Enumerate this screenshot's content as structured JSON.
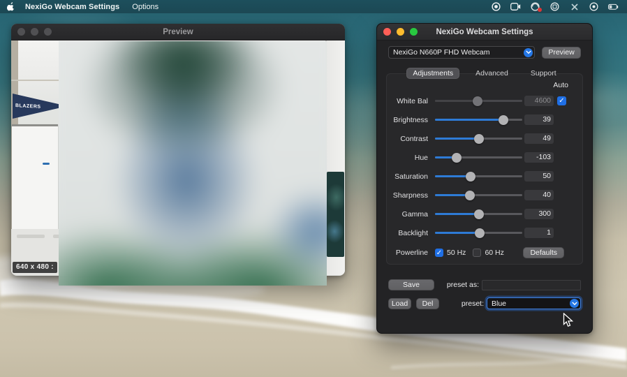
{
  "colors": {
    "accent_blue": "#2e7bd6",
    "checkbox_blue": "#1f6fe5",
    "traffic_red": "#ff5f57",
    "traffic_yellow": "#febc2e",
    "traffic_green": "#28c840"
  },
  "menu_bar": {
    "app_name": "NexiGo Webcam Settings",
    "menus": [
      {
        "label": "Options"
      }
    ],
    "status_icons": [
      "record-icon",
      "video-camera-icon",
      "meeting-red-badge-icon",
      "circled-grid-icon",
      "x-tool-icon",
      "circled-dot-icon",
      "battery-icon"
    ]
  },
  "preview_window": {
    "title": "Preview",
    "resolution_badge": "640 x 480 :",
    "pennant_text": "BLAZERS"
  },
  "settings_window": {
    "title": "NexiGo Webcam Settings",
    "device_select": {
      "value": "NexiGo N660P FHD Webcam"
    },
    "preview_button": "Preview",
    "tabs": [
      {
        "label": "Adjustments",
        "active": true
      },
      {
        "label": "Advanced",
        "active": false
      },
      {
        "label": "Support",
        "active": false
      }
    ],
    "auto_label": "Auto",
    "auto_checked": true,
    "sliders": [
      {
        "label": "White Bal",
        "value": "4600",
        "fraction": 0.49,
        "disabled": true
      },
      {
        "label": "Brightness",
        "value": "39",
        "fraction": 0.78,
        "disabled": false
      },
      {
        "label": "Contrast",
        "value": "49",
        "fraction": 0.5,
        "disabled": false
      },
      {
        "label": "Hue",
        "value": "-103",
        "fraction": 0.25,
        "disabled": false
      },
      {
        "label": "Saturation",
        "value": "50",
        "fraction": 0.41,
        "disabled": false
      },
      {
        "label": "Sharpness",
        "value": "40",
        "fraction": 0.4,
        "disabled": false
      },
      {
        "label": "Gamma",
        "value": "300",
        "fraction": 0.5,
        "disabled": false
      },
      {
        "label": "Backlight",
        "value": "1",
        "fraction": 0.51,
        "disabled": false
      }
    ],
    "powerline": {
      "label": "Powerline",
      "options": [
        {
          "label": "50 Hz",
          "checked": true
        },
        {
          "label": "60 Hz",
          "checked": false
        }
      ]
    },
    "defaults_button": "Defaults",
    "save_button": "Save",
    "load_button": "Load",
    "del_button": "Del",
    "preset_as_label": "preset as:",
    "preset_as_value": "",
    "preset_label": "preset:",
    "preset_value": "Blue"
  }
}
